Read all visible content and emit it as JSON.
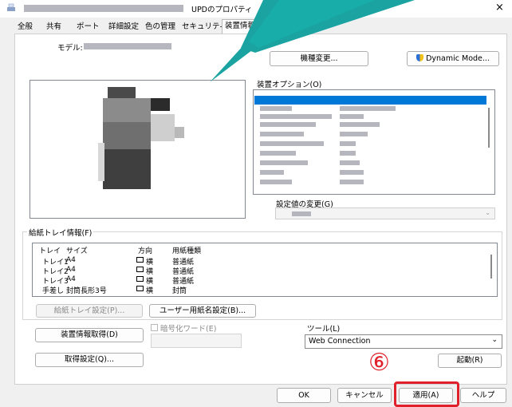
{
  "window": {
    "title_suffix": "UPDのプロパティ",
    "close_glyph": "×"
  },
  "tabs": [
    "全般",
    "共有",
    "ポート",
    "詳細設定",
    "色の管理",
    "セキュリティ",
    "装置情報"
  ],
  "model": {
    "label": "モデル:",
    "change_button": "機種変更...",
    "dynamic_mode_button": "Dynamic Mode..."
  },
  "options": {
    "label": "装置オプション(O)",
    "setting_change_label": "設定値の変更(G)"
  },
  "tray": {
    "label": "給紙トレイ情報(F)",
    "headers": [
      "トレイ",
      "サイズ",
      "方向",
      "用紙種類"
    ],
    "rows": [
      [
        "トレイ1",
        "A4",
        "横",
        "普通紙"
      ],
      [
        "トレイ2",
        "A4",
        "横",
        "普通紙"
      ],
      [
        "トレイ3",
        "A4",
        "横",
        "普通紙"
      ],
      [
        "手差し",
        "封筒長形3号",
        "横",
        "封筒"
      ]
    ],
    "tray_settings_button": "給紙トレイ設定(P)...",
    "user_paper_button": "ユーザー用紙名設定(B)..."
  },
  "encryption": {
    "label": "暗号化ワード(E)"
  },
  "device": {
    "get_info_button": "装置情報取得(D)",
    "get_settings_button": "取得設定(Q)..."
  },
  "tools": {
    "label": "ツール(L)",
    "selected": "Web Connection",
    "launch_button": "起動(R)"
  },
  "footer": {
    "ok": "OK",
    "cancel": "キャンセル",
    "apply": "適用(A)",
    "help": "ヘルプ"
  },
  "annotation": {
    "step_number": "⑥",
    "highlight_color": "#e0202a",
    "arrow_color": "#1aa3a0"
  }
}
